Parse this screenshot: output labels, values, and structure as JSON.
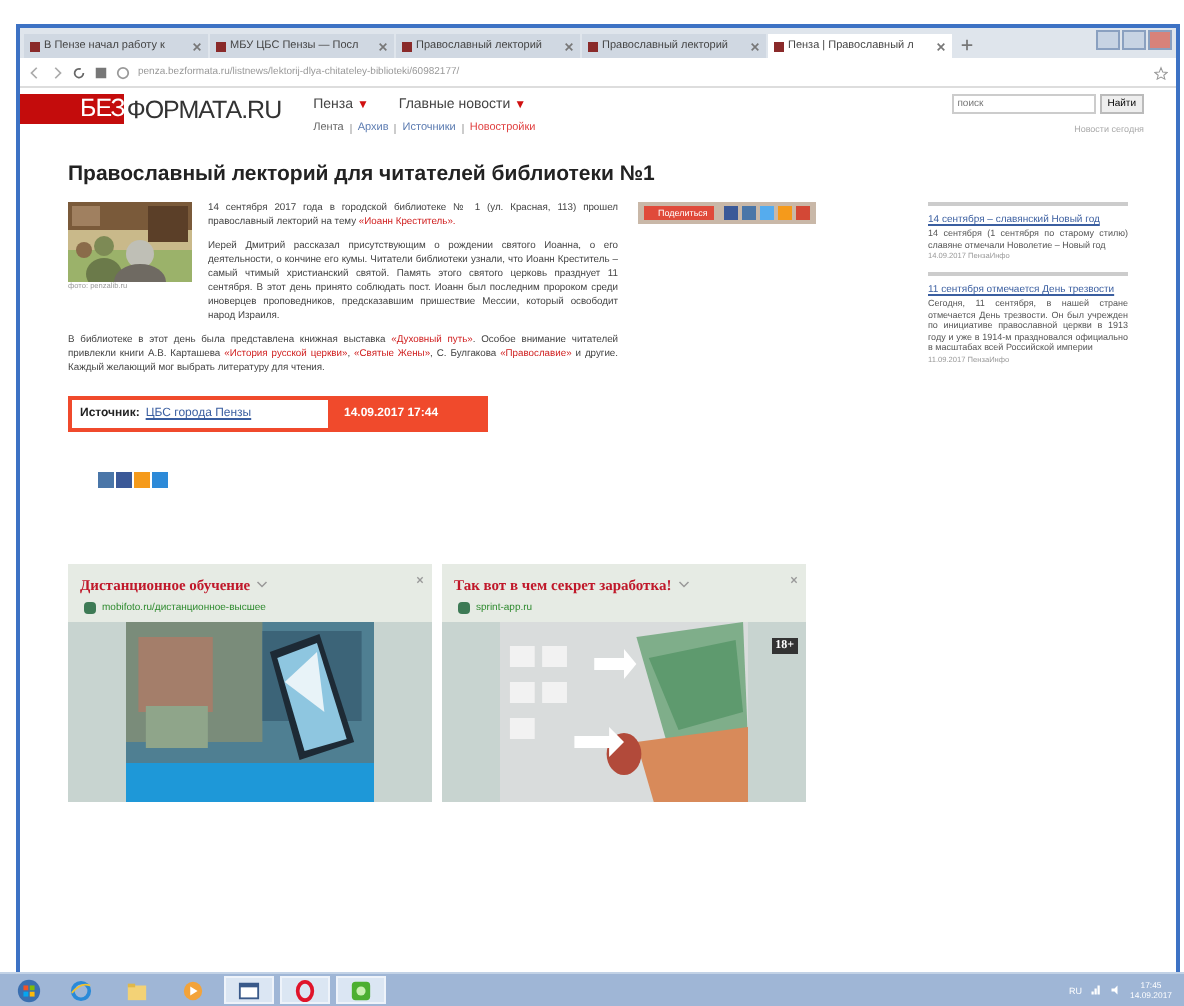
{
  "browser": {
    "tabs": [
      {
        "title": "В Пензе начал работу к",
        "selected": false
      },
      {
        "title": "МБУ ЦБС Пензы — Посл",
        "selected": false
      },
      {
        "title": "Православный лекторий",
        "selected": false
      },
      {
        "title": "Православный лекторий",
        "selected": false
      },
      {
        "title": "Пенза | Православный л",
        "selected": true
      }
    ],
    "url": "penza.bezformata.ru/listnews/lektorij-dlya-chitateley-biblioteki/60982177/"
  },
  "site": {
    "logo_prefix": "БЕЗ",
    "logo_rest": "ФОРМАТА.RU",
    "nav": [
      {
        "label": "Пенза"
      },
      {
        "label": "Главные новости"
      }
    ],
    "nav_marker": "▼",
    "subnav": [
      {
        "label": "Лента",
        "highlight": false
      },
      {
        "label": "Архив",
        "highlight": false
      },
      {
        "label": "Источники",
        "highlight": false
      },
      {
        "label": "Новостройки",
        "highlight": true
      }
    ],
    "search_placeholder": "поиск",
    "search_button": "Найти",
    "corner_link": "Новости сегодня"
  },
  "article": {
    "title": "Православный лекторий для читателей библиотеки №1",
    "photo_caption": "фото: penzalib.ru",
    "paragraphs": [
      [
        {
          "text": "14 сентября 2017 года в городской библиотеке № 1 (ул. Красная, 113) прошел православный лекторий на тему ",
          "link": false
        },
        {
          "text": "«Иоанн Креститель».",
          "link": true
        }
      ],
      [
        {
          "text": "Иерей Дмитрий рассказал присутствующим о рождении святого Иоанна, о его деятельности, о кончине его кумы. Читатели библиотеки узнали, что Иоанн Креститель – самый чтимый христианский святой. Память этого святого церковь празднует 11 сентября. В этот день принято соблюдать пост. Иоанн был последним пророком среди иноверцев проповедников, предсказавшим пришествие Мессии, который освободит народ Израиля.",
          "link": false
        }
      ],
      [
        {
          "text": "В библиотеке в этот день была представлена книжная выставка ",
          "link": false
        },
        {
          "text": "«Духовный путь»",
          "link": true
        },
        {
          "text": ". Особое внимание читателей привлекли книги А.В. Карташева ",
          "link": false
        },
        {
          "text": "«История русской церкви»",
          "link": true
        },
        {
          "text": ", ",
          "link": false
        },
        {
          "text": "«Святые Жены»",
          "link": true
        },
        {
          "text": ", С. Булгакова ",
          "link": false
        },
        {
          "text": "«Православие»",
          "link": true
        },
        {
          "text": " и другие. Каждый желающий мог выбрать литературу для чтения.",
          "link": false
        }
      ]
    ]
  },
  "share": {
    "label": "Поделиться",
    "services": [
      {
        "color": "#3b5998"
      },
      {
        "color": "#4a76a8"
      },
      {
        "color": "#55acee"
      },
      {
        "color": "#f59a1b"
      },
      {
        "color": "#d34836"
      }
    ]
  },
  "source": {
    "label": "Источник:",
    "name": "ЦБС города Пензы",
    "datetime": "14.09.2017 17:44"
  },
  "social": [
    {
      "color": "#4a76a8"
    },
    {
      "color": "#3b5998"
    },
    {
      "color": "#f59a1b"
    },
    {
      "color": "#2d8ad8"
    }
  ],
  "sidebar": [
    {
      "title": "14 сентября – славянский Новый год",
      "summary": "14 сентября (1 сентября по старому стилю) славяне отмечали Новолетие – Новый год",
      "meta": "14.09.2017 ПензаИнфо"
    },
    {
      "title": "11 сентября отмечается День трезвости",
      "summary": "Сегодня, 11 сентября, в нашей стране отмечается День трезвости. Он был учрежден по инициативе православной церкви в 1913 году и уже в 1914-м праздновался официально в масштабах всей Российской империи",
      "meta": "11.09.2017 ПензаИнфо"
    }
  ],
  "ads": [
    {
      "kind": "phone",
      "title": "Дистанционное обучение",
      "source": "mobifoto.ru/дистанционное-высшее"
    },
    {
      "kind": "money",
      "title": "Так вот в чем секрет заработка!",
      "source": "sprint-app.ru",
      "badge": "18+"
    }
  ],
  "taskbar": {
    "apps": [
      {
        "kind": "ie",
        "selected": false
      },
      {
        "kind": "folder",
        "selected": false
      },
      {
        "kind": "media",
        "selected": false
      },
      {
        "kind": "window",
        "selected": true
      },
      {
        "kind": "opera",
        "selected": true
      },
      {
        "kind": "green",
        "selected": true
      }
    ],
    "language": "RU",
    "time": "17:45",
    "date": "14.09.2017"
  }
}
